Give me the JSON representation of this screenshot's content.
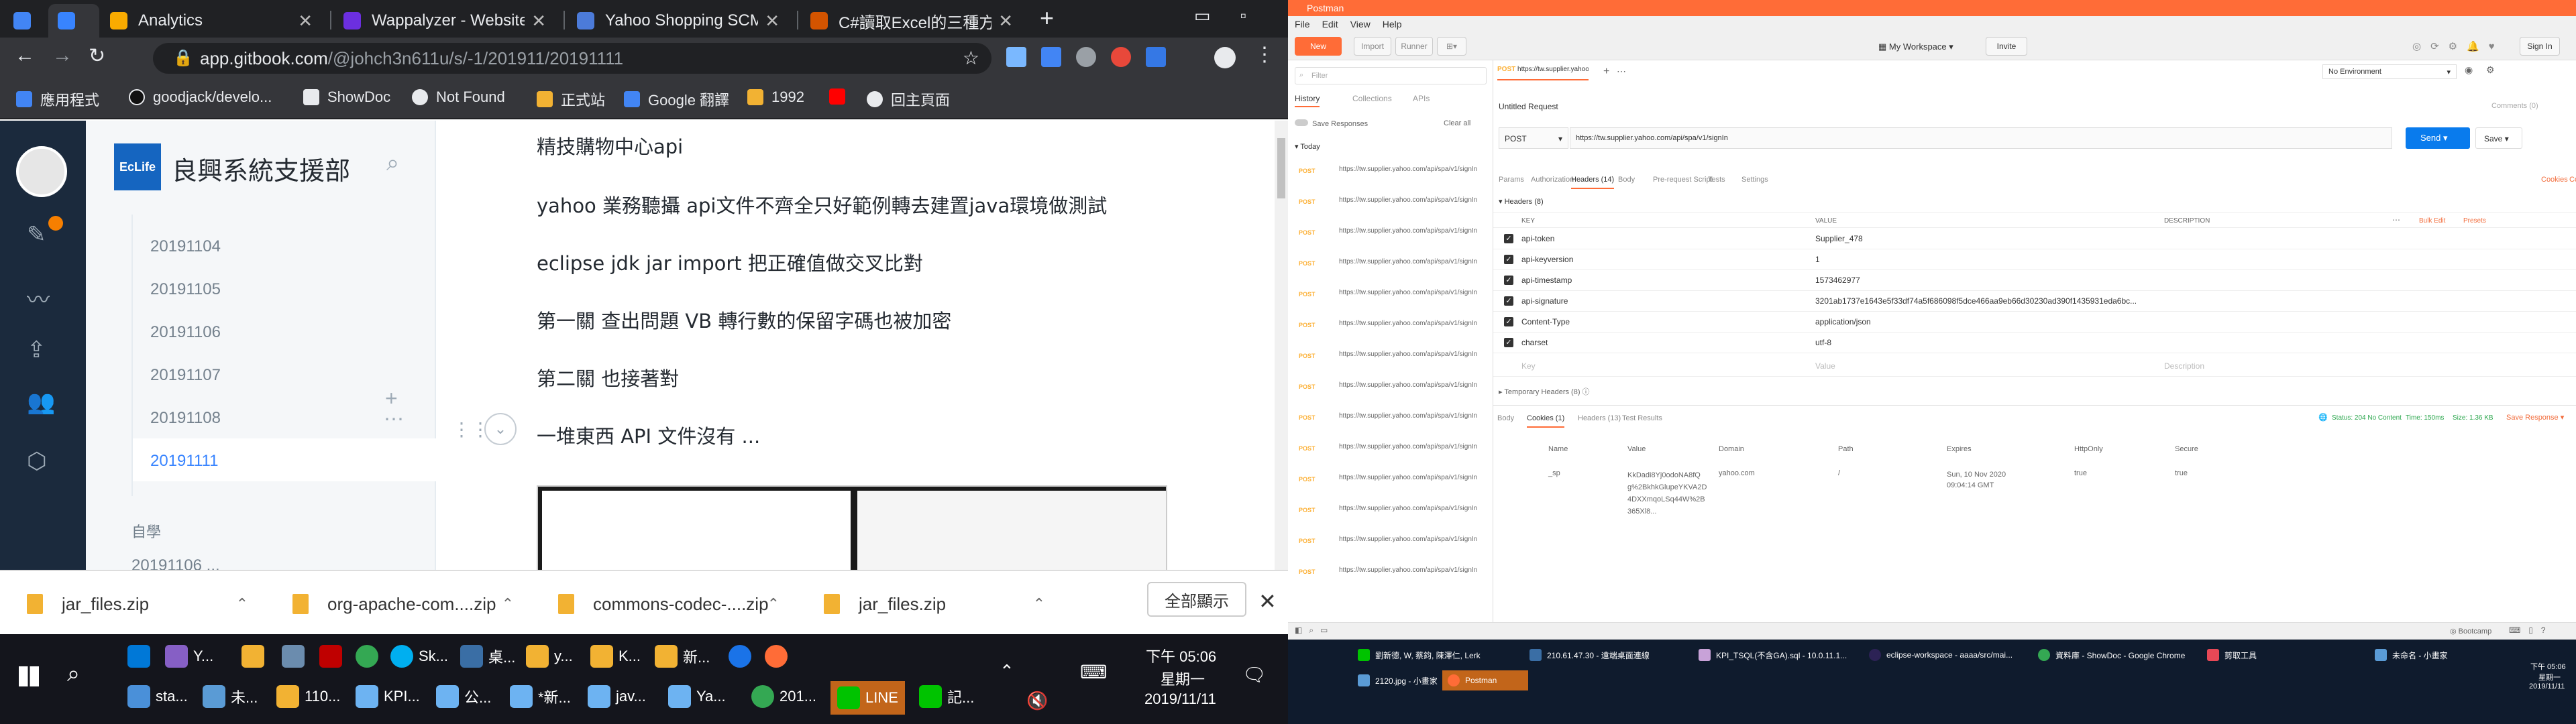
{
  "left": {
    "tabs": [
      {
        "label": "",
        "color": "#4285f4"
      },
      {
        "label": "",
        "color": "#3884ff"
      },
      {
        "label": "Analytics",
        "color": "#f9ab00"
      },
      {
        "label": "Wappalyzer - Websites",
        "color": "#6c2fe0"
      },
      {
        "label": "Yahoo Shopping SCM",
        "color": "#4c7bd9"
      },
      {
        "label": "C#讀取Excel的三種方式",
        "color": "#d35400"
      }
    ],
    "url_host": "app.gitbook.com",
    "url_path": "/@johch3n611u/s/-1/201911/20191111",
    "bookmarks": [
      {
        "label": "應用程式",
        "color": "#4285f4"
      },
      {
        "label": "goodjack/develo...",
        "color": "#111111"
      },
      {
        "label": "ShowDoc",
        "color": "#e8eaed"
      },
      {
        "label": "Not Found",
        "color": "#e8eaed"
      },
      {
        "label": "正式站",
        "color": "#f2b233"
      },
      {
        "label": "Google 翻譯",
        "color": "#4285f4"
      },
      {
        "label": "1992",
        "color": "#f2b233"
      },
      {
        "label": "",
        "color": "#ff0000"
      },
      {
        "label": "回主頁面",
        "color": "#e8eaed"
      }
    ],
    "space_title": "良興系統支援部",
    "nav_items": [
      "20191104",
      "20191105",
      "20191106",
      "20191107",
      "20191108",
      "20191111"
    ],
    "nav_section": "自學",
    "nav_partial": "20191106 ...",
    "paragraphs": [
      "精技購物中心api",
      "yahoo 業務聽攝 api文件不齊全只好範例轉去建置java環境做測試",
      "eclipse jdk jar import    把正確值做交叉比對",
      "第一關 查出問題 VB 轉行數的保留字碼也被加密",
      "第二關 也接著對",
      "一堆東西 API 文件沒有 ..."
    ],
    "downloads": [
      "jar_files.zip",
      "org-apache-com....zip",
      "commons-codec-....zip",
      "jar_files.zip"
    ],
    "show_all": "全部顯示",
    "taskbar_row1": [
      "Y...",
      "Sk...",
      "桌...",
      "y...",
      "K...",
      "新..."
    ],
    "taskbar_row2": [
      "sta...",
      "未...",
      "110...",
      "KPI...",
      "公...",
      "*新...",
      "jav...",
      "Ya...",
      "201...",
      "LINE",
      "記..."
    ],
    "clock_time": "下午 05:06",
    "clock_day": "星期一",
    "clock_date": "2019/11/11"
  },
  "right": {
    "title": "Postman",
    "menu": [
      "File",
      "Edit",
      "View",
      "Help"
    ],
    "toolbar": {
      "new": "New",
      "import": "Import",
      "runner": "Runner",
      "workspace": "My Workspace",
      "invite": "Invite",
      "signin": "Sign In"
    },
    "filter_placeholder": "Filter",
    "side_tabs": [
      "History",
      "Collections",
      "APIs"
    ],
    "save_responses": "Save Responses",
    "clear_all": "Clear all",
    "today": "Today",
    "history_method": "POST",
    "history_url": "https://tw.supplier.yahoo.com/api/spa/v1/signIn",
    "history_count": 14,
    "request_tab": "https://tw.supplier.yahoo.co...",
    "request_tab_method": "POST",
    "environment": "No Environment",
    "request_title": "Untitled Request",
    "comments": "Comments (0)",
    "method": "POST",
    "url": "https://tw.supplier.yahoo.com/api/spa/v1/signIn",
    "send": "Send",
    "save": "Save",
    "req_tabs": [
      "Params",
      "Authorization",
      "Headers (14)",
      "Body",
      "Pre-request Script",
      "Tests",
      "Settings"
    ],
    "cookies_code": [
      "Cookies",
      "Code"
    ],
    "headers_section": "Headers (8)",
    "col_key": "KEY",
    "col_value": "VALUE",
    "col_desc": "DESCRIPTION",
    "bulk_edit": "Bulk Edit",
    "presets": "Presets",
    "headers": [
      {
        "key": "api-token",
        "value": "Supplier_478"
      },
      {
        "key": "api-keyversion",
        "value": "1"
      },
      {
        "key": "api-timestamp",
        "value": "1573462977"
      },
      {
        "key": "api-signature",
        "value": "3201ab1737e1643e5f33df74a5f686098f5dce466aa9eb66d30230ad390f1435931eda6bc..."
      },
      {
        "key": "Content-Type",
        "value": "application/json"
      },
      {
        "key": "charset",
        "value": "utf-8"
      }
    ],
    "key_placeholder": "Key",
    "value_placeholder": "Value",
    "desc_placeholder": "Description",
    "temp_headers": "Temporary Headers (8)",
    "resp_tabs": [
      "Body",
      "Cookies (1)",
      "Headers (13)",
      "Test Results"
    ],
    "status": "Status: 204 No Content",
    "time": "Time: 150ms",
    "size": "Size: 1.36 KB",
    "save_response": "Save Response",
    "cookie_cols": [
      "Name",
      "Value",
      "Domain",
      "Path",
      "Expires",
      "HttpOnly",
      "Secure"
    ],
    "cookie": {
      "name": "_sp",
      "value": "KkDadi8Yj0odoNA8fQg%2BkhkGlupeYKVA2D4DXXmqoLSq44W%2B365Xl8...",
      "domain": "yahoo.com",
      "path": "/",
      "expires": "Sun, 10 Nov 2020 09:04:14 GMT",
      "httponly": "true",
      "secure": "true"
    },
    "bootcamp": "Bootcamp",
    "taskbar_row1": [
      "劉新德, W, 蔡鈞, 陳澤仁, Lerk",
      "210.61.47.30 - 遠端桌面連線",
      "KPI_TSQL(不含GA).sql - 10.0.11.1...",
      "eclipse-workspace - aaaa/src/mai...",
      "資料庫 - ShowDoc - Google Chrome",
      "剪取工具",
      "未命名 - 小畫家"
    ],
    "taskbar_row2": [
      "2120.jpg - 小畫家",
      "Postman"
    ],
    "clock_time": "下午 05:06",
    "clock_day": "星期一",
    "clock_date": "2019/11/11"
  }
}
